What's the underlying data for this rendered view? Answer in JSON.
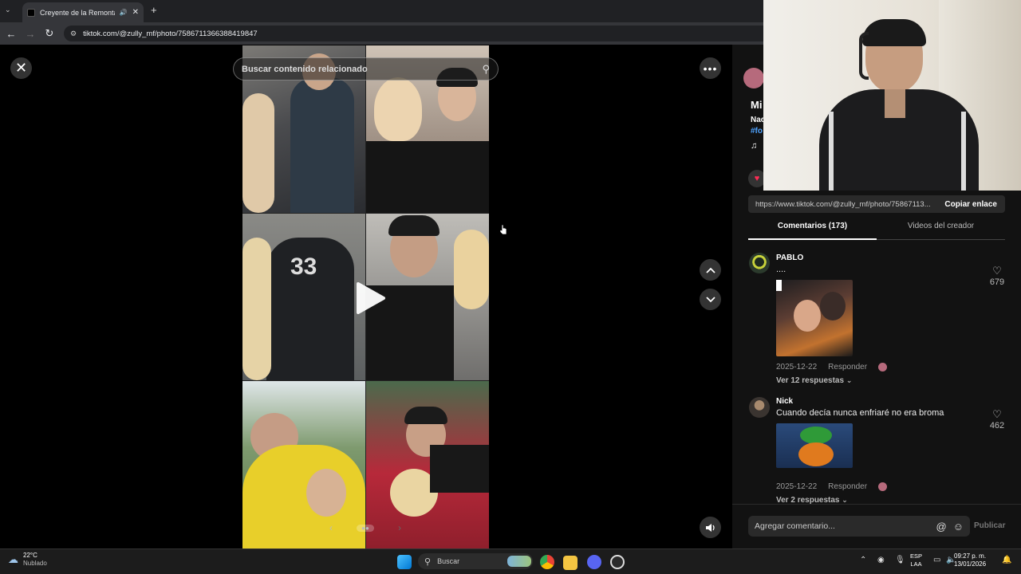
{
  "browser": {
    "tab_title": "Creyente de la Remontada",
    "new_tab": "+",
    "url": "tiktok.com/@zully_mf/photo/7586711366388419847"
  },
  "viewer": {
    "close": "✕",
    "more": "•••",
    "search_placeholder": "Buscar contenido relacionado",
    "up": "⌃",
    "down": "⌄"
  },
  "post": {
    "author_partial": "Mi",
    "desc_partial": "Nac",
    "hashtag_partial": "#fo",
    "music_icon": "♫",
    "share_url": "https://www.tiktok.com/@zully_mf/photo/75867113...",
    "copy_link": "Copiar enlace"
  },
  "tabs": {
    "comments": "Comentarios (173)",
    "videos": "Videos del creador"
  },
  "comments": [
    {
      "name": "PABLO",
      "text": "....",
      "date": "2025-12-22",
      "reply": "Responder",
      "likes": "679",
      "replies": "Ver 12 respuestas"
    },
    {
      "name": "Nick",
      "text": "Cuando decía nunca enfriaré no era broma",
      "date": "2025-12-22",
      "reply": "Responder",
      "likes": "462",
      "replies": "Ver 2 respuestas"
    }
  ],
  "comment_box": {
    "placeholder": "Agregar comentario...",
    "publish": "Publicar"
  },
  "taskbar": {
    "temp": "22°C",
    "weather": "Nublado",
    "search": "Buscar",
    "lang1": "ESP",
    "lang2": "LAA",
    "time": "09:27 p. m.",
    "date": "13/01/2026"
  },
  "colors": {
    "accent_pink": "#fe2c55",
    "hashtag_blue": "#4fa3ff",
    "panel_bg": "#121212"
  }
}
